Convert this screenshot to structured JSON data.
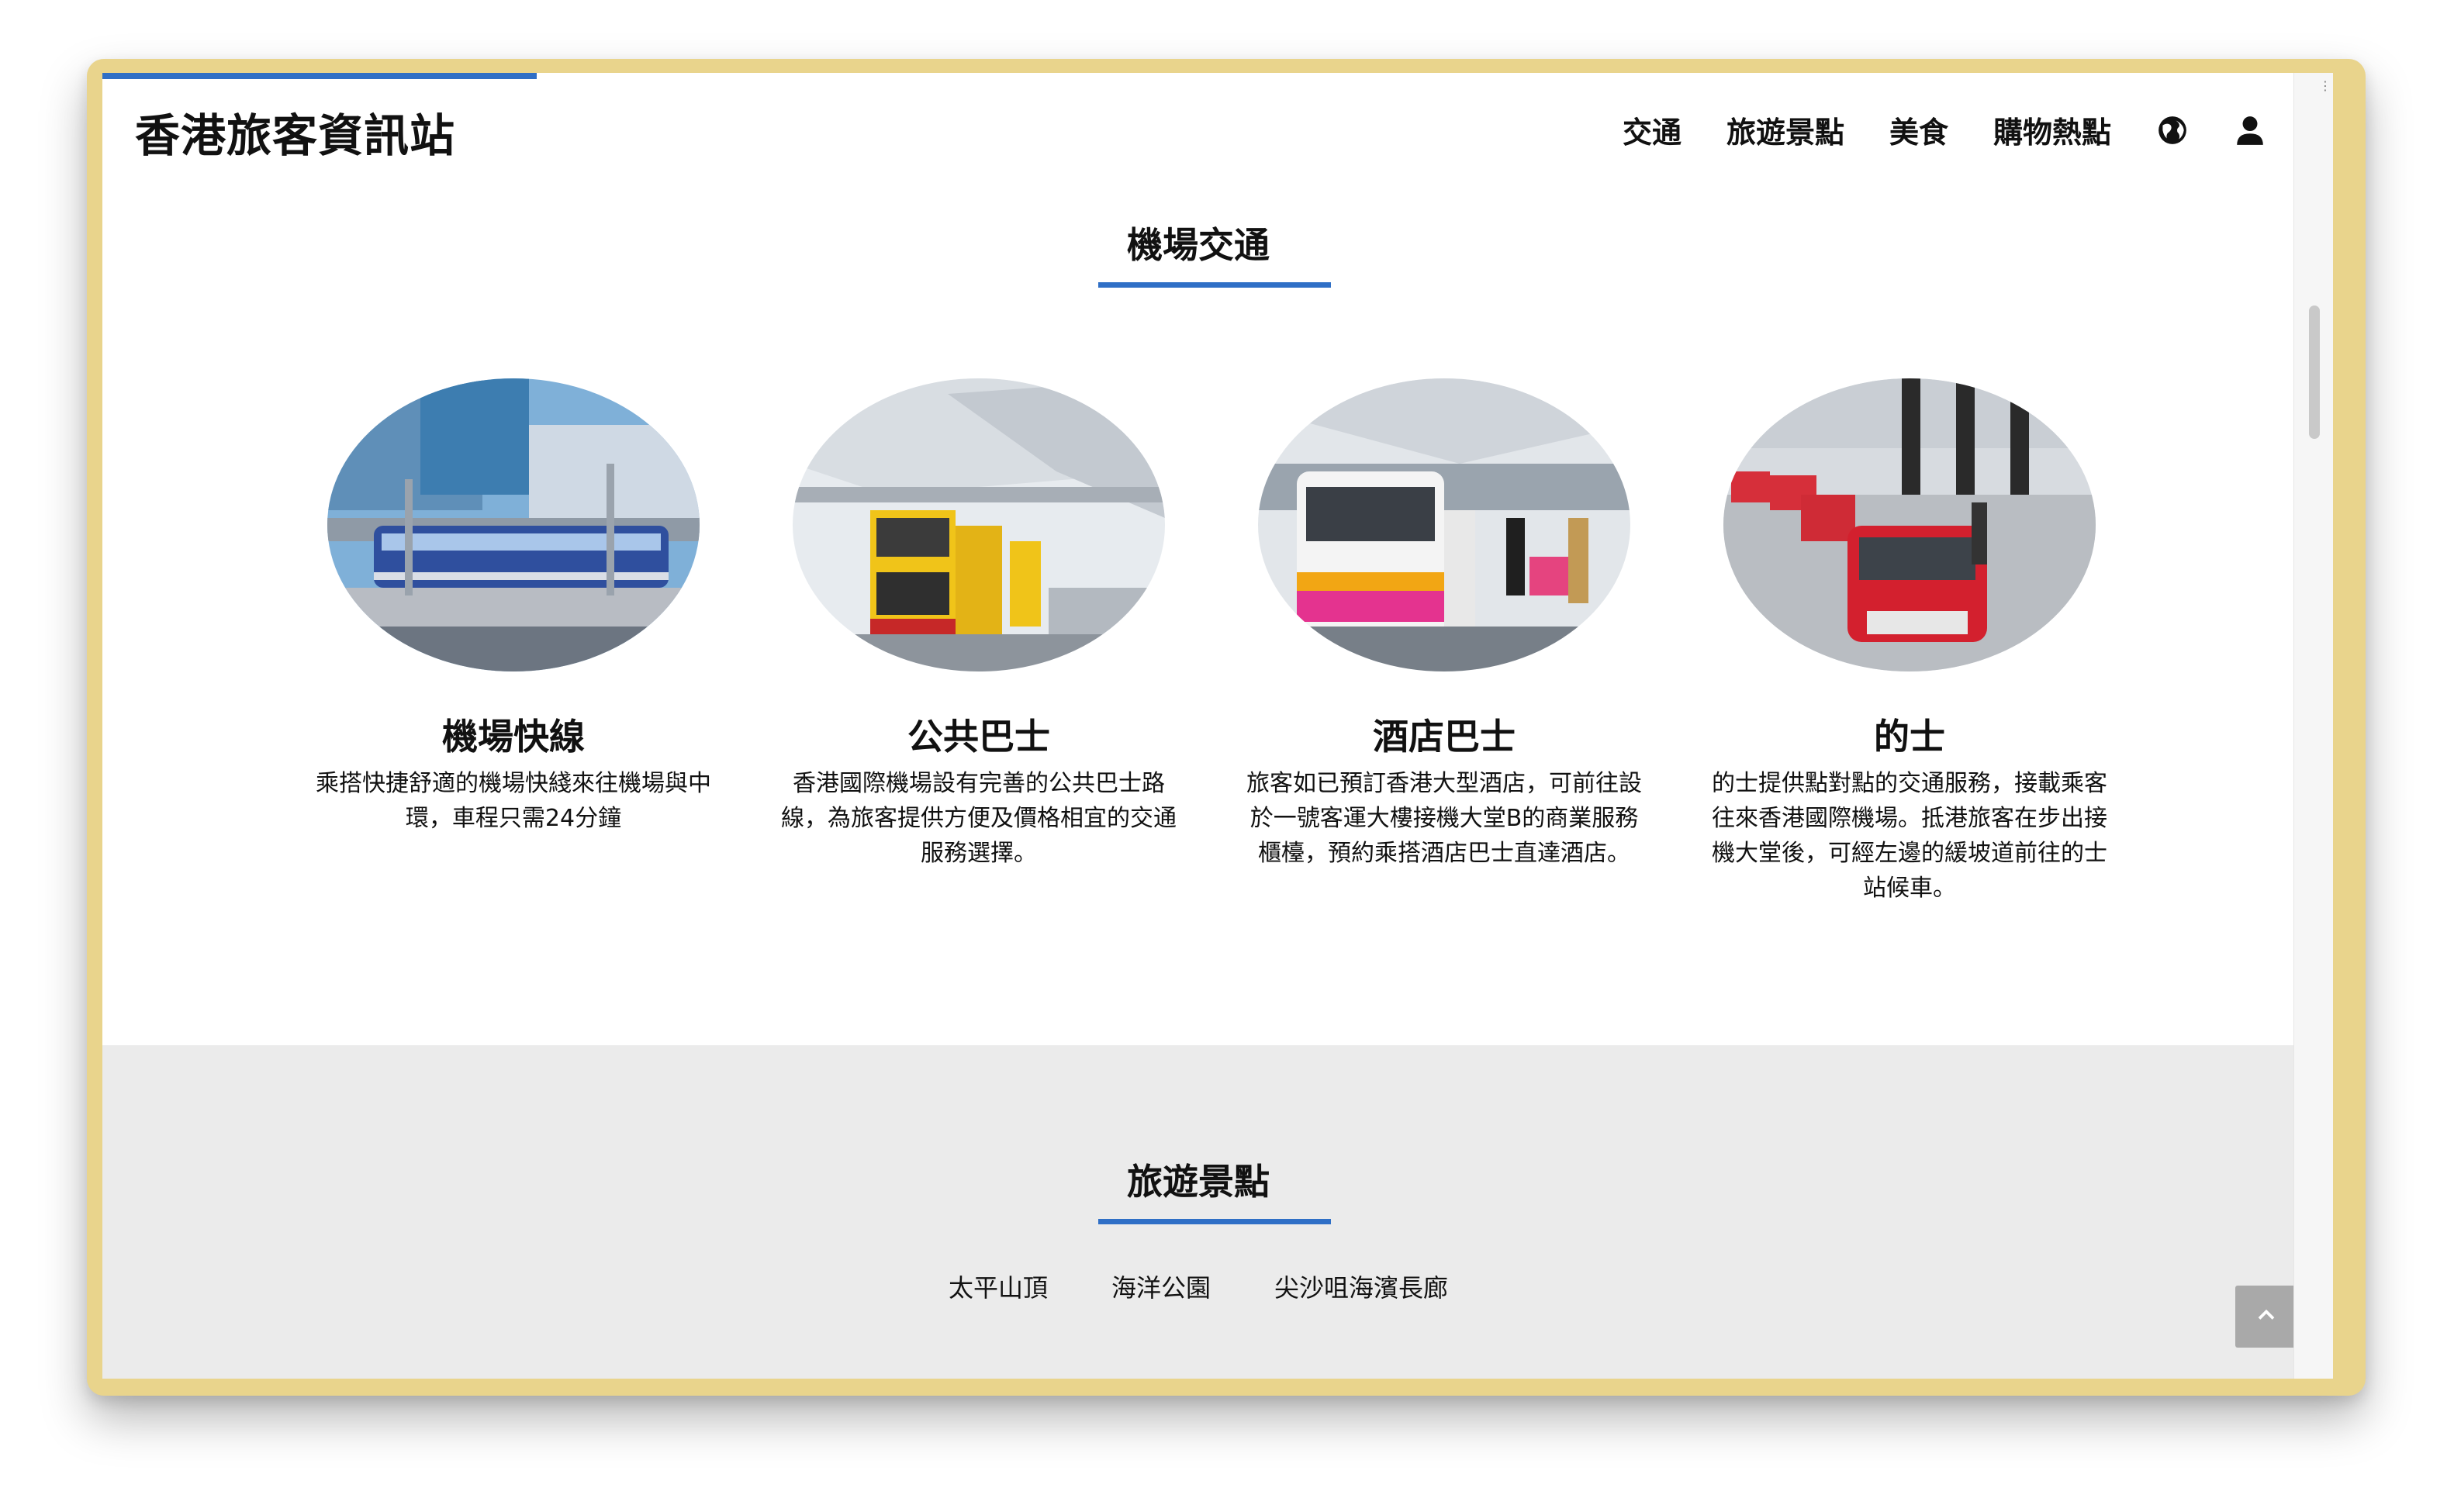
{
  "site": {
    "title": "香港旅客資訊站",
    "nav": [
      "交通",
      "旅遊景點",
      "美食",
      "購物熱點"
    ],
    "icons": [
      "globe-icon",
      "user-icon"
    ]
  },
  "airport_section": {
    "title": "機場交通",
    "cards": [
      {
        "title": "機場快線",
        "text": "乘搭快捷舒適的機場快綫來往機場與中環，車程只需24分鐘",
        "image": "airport-express-train"
      },
      {
        "title": "公共巴士",
        "text": "香港國際機場設有完善的公共巴士路線，為旅客提供方便及價格相宜的交通服務選擇。",
        "image": "double-decker-bus"
      },
      {
        "title": "酒店巴士",
        "text": "旅客如已預訂香港大型酒店，可前往設於一號客運大樓接機大堂B的商業服務櫃檯，預約乘搭酒店巴士直達酒店。",
        "image": "hotel-minibus"
      },
      {
        "title": "的士",
        "text": "的士提供點對點的交通服務，接載乘客往來香港國際機場。抵港旅客在步出接機大堂後，可經左邊的緩坡道前往的士站候車。",
        "image": "red-taxis"
      }
    ]
  },
  "attractions_section": {
    "title": "旅遊景點",
    "tabs": [
      "太平山頂",
      "海洋公園",
      "尖沙咀海濱長廊"
    ]
  },
  "colors": {
    "accent": "#2f6fc6",
    "frame": "#e9d48c",
    "grey_section": "#ebebeb",
    "back_to_top": "#a9a9a9"
  },
  "controls": {
    "back_to_top_icon": "chevron-up-icon"
  }
}
